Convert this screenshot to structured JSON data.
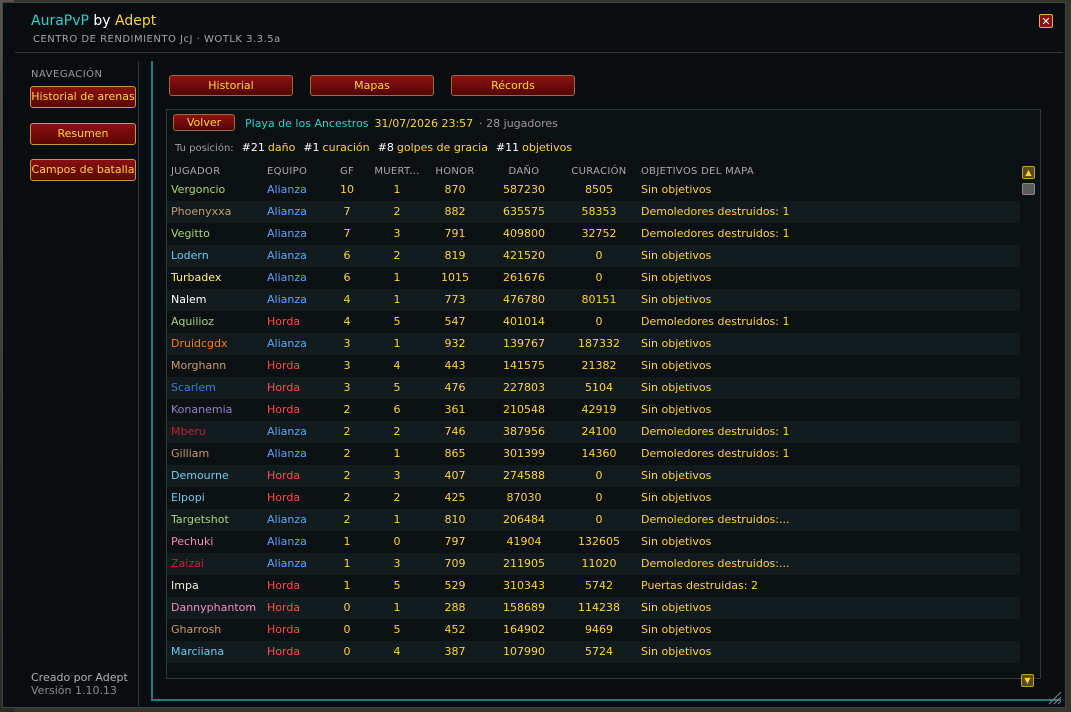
{
  "window": {
    "addon_name": "AuraPvP",
    "by": "by",
    "author": "Adept",
    "subtitle": "CENTRO DE RENDIMIENTO JcJ · WOTLK 3.3.5a",
    "close_glyph": "✕"
  },
  "sidebar": {
    "heading": "NAVEGACIÓN",
    "items": [
      {
        "label": "Historial de arenas"
      },
      {
        "label": "Resumen"
      },
      {
        "label": "Campos de batalla"
      }
    ],
    "credit": "Creado por Adept",
    "version": "Versión 1.10.13"
  },
  "tabs": [
    {
      "label": "Historial"
    },
    {
      "label": "Mapas"
    },
    {
      "label": "Récords"
    }
  ],
  "battle": {
    "back_label": "Volver",
    "map": "Playa de los Ancestros",
    "date": "31/07/2026 23:57",
    "players": "· 28 jugadores"
  },
  "position": {
    "label": "Tu posición:",
    "ranks": [
      {
        "rank": "#21",
        "category": "daño"
      },
      {
        "rank": "#1",
        "category": "curación"
      },
      {
        "rank": "#8",
        "category": "golpes de gracia"
      },
      {
        "rank": "#11",
        "category": "objetivos"
      }
    ]
  },
  "table": {
    "headers": [
      "JUGADOR",
      "EQUIPO",
      "GF",
      "MUERT...",
      "HONOR",
      "DAÑO",
      "CURACIÓN",
      "OBJETIVOS DEL MAPA"
    ],
    "rows": [
      {
        "player": "Vergoncio",
        "team": "Alianza",
        "gf": "10",
        "deaths": "1",
        "honor": "870",
        "damage": "587230",
        "healing": "8505",
        "objectives": "Sin objetivos",
        "color": "#aad372"
      },
      {
        "player": "Phoenyxxa",
        "team": "Alianza",
        "gf": "7",
        "deaths": "2",
        "honor": "882",
        "damage": "635575",
        "healing": "58353",
        "objectives": "Demoledores destruidos: 1",
        "color": "#c79c6e"
      },
      {
        "player": "Vegitto",
        "team": "Alianza",
        "gf": "7",
        "deaths": "3",
        "honor": "791",
        "damage": "409800",
        "healing": "32752",
        "objectives": "Demoledores destruidos: 1",
        "color": "#aad372"
      },
      {
        "player": "Lodern",
        "team": "Alianza",
        "gf": "6",
        "deaths": "2",
        "honor": "819",
        "damage": "421520",
        "healing": "0",
        "objectives": "Sin objetivos",
        "color": "#69ccf0"
      },
      {
        "player": "Turbadex",
        "team": "Alianza",
        "gf": "6",
        "deaths": "1",
        "honor": "1015",
        "damage": "261676",
        "healing": "0",
        "objectives": "Sin objetivos",
        "color": "#fff569"
      },
      {
        "player": "Nalem",
        "team": "Alianza",
        "gf": "4",
        "deaths": "1",
        "honor": "773",
        "damage": "476780",
        "healing": "80151",
        "objectives": "Sin objetivos",
        "color": "#ffffff"
      },
      {
        "player": "Aquilioz",
        "team": "Horda",
        "gf": "4",
        "deaths": "5",
        "honor": "547",
        "damage": "401014",
        "healing": "0",
        "objectives": "Demoledores destruidos: 1",
        "color": "#aad372"
      },
      {
        "player": "Druidcgdx",
        "team": "Alianza",
        "gf": "3",
        "deaths": "1",
        "honor": "932",
        "damage": "139767",
        "healing": "187332",
        "objectives": "Sin objetivos",
        "color": "#ff7d0a"
      },
      {
        "player": "Morghann",
        "team": "Horda",
        "gf": "3",
        "deaths": "4",
        "honor": "443",
        "damage": "141575",
        "healing": "21382",
        "objectives": "Sin objetivos",
        "color": "#c79c6e"
      },
      {
        "player": "Scarlem",
        "team": "Horda",
        "gf": "3",
        "deaths": "5",
        "honor": "476",
        "damage": "227803",
        "healing": "5104",
        "objectives": "Sin objetivos",
        "color": "#2f7fe0"
      },
      {
        "player": "Konanemia",
        "team": "Horda",
        "gf": "2",
        "deaths": "6",
        "honor": "361",
        "damage": "210548",
        "healing": "42919",
        "objectives": "Sin objetivos",
        "color": "#9482c9"
      },
      {
        "player": "Mberu",
        "team": "Alianza",
        "gf": "2",
        "deaths": "2",
        "honor": "746",
        "damage": "387956",
        "healing": "24100",
        "objectives": "Demoledores destruidos: 1",
        "color": "#c41f3b"
      },
      {
        "player": "Gilliam",
        "team": "Alianza",
        "gf": "2",
        "deaths": "1",
        "honor": "865",
        "damage": "301399",
        "healing": "14360",
        "objectives": "Demoledores destruidos: 1",
        "color": "#c79c6e"
      },
      {
        "player": "Demourne",
        "team": "Horda",
        "gf": "2",
        "deaths": "3",
        "honor": "407",
        "damage": "274588",
        "healing": "0",
        "objectives": "Sin objetivos",
        "color": "#69ccf0"
      },
      {
        "player": "Elpopi",
        "team": "Horda",
        "gf": "2",
        "deaths": "2",
        "honor": "425",
        "damage": "87030",
        "healing": "0",
        "objectives": "Sin objetivos",
        "color": "#69ccf0"
      },
      {
        "player": "Targetshot",
        "team": "Alianza",
        "gf": "2",
        "deaths": "1",
        "honor": "810",
        "damage": "206484",
        "healing": "0",
        "objectives": "Demoledores destruidos:...",
        "color": "#aad372"
      },
      {
        "player": "Pechuki",
        "team": "Alianza",
        "gf": "1",
        "deaths": "0",
        "honor": "797",
        "damage": "41904",
        "healing": "132605",
        "objectives": "Sin objetivos",
        "color": "#f58cba"
      },
      {
        "player": "Zaizai",
        "team": "Alianza",
        "gf": "1",
        "deaths": "3",
        "honor": "709",
        "damage": "211905",
        "healing": "11020",
        "objectives": "Demoledores destruidos:...",
        "color": "#c41f3b"
      },
      {
        "player": "Impa",
        "team": "Horda",
        "gf": "1",
        "deaths": "5",
        "honor": "529",
        "damage": "310343",
        "healing": "5742",
        "objectives": "Puertas destruidas: 2",
        "color": "#f0ebe0"
      },
      {
        "player": "Dannyphantom",
        "team": "Horda",
        "gf": "0",
        "deaths": "1",
        "honor": "288",
        "damage": "158689",
        "healing": "114238",
        "objectives": "Sin objetivos",
        "color": "#f58cba"
      },
      {
        "player": "Gharrosh",
        "team": "Horda",
        "gf": "0",
        "deaths": "5",
        "honor": "452",
        "damage": "164902",
        "healing": "9469",
        "objectives": "Sin objetivos",
        "color": "#c79c6e"
      },
      {
        "player": "Marciiana",
        "team": "Horda",
        "gf": "0",
        "deaths": "4",
        "honor": "387",
        "damage": "107990",
        "healing": "5724",
        "objectives": "Sin objetivos",
        "color": "#69ccf0"
      }
    ]
  },
  "colors": {
    "alianza": "#5ea2ff",
    "horda": "#ff4d4d",
    "gold": "#ffd23a",
    "cyan": "#33d0cf"
  },
  "icons": {
    "scroll_up": "scroll-up-arrow-icon",
    "scroll_down": "scroll-down-arrow-icon",
    "resize": "resize-grip-icon"
  }
}
